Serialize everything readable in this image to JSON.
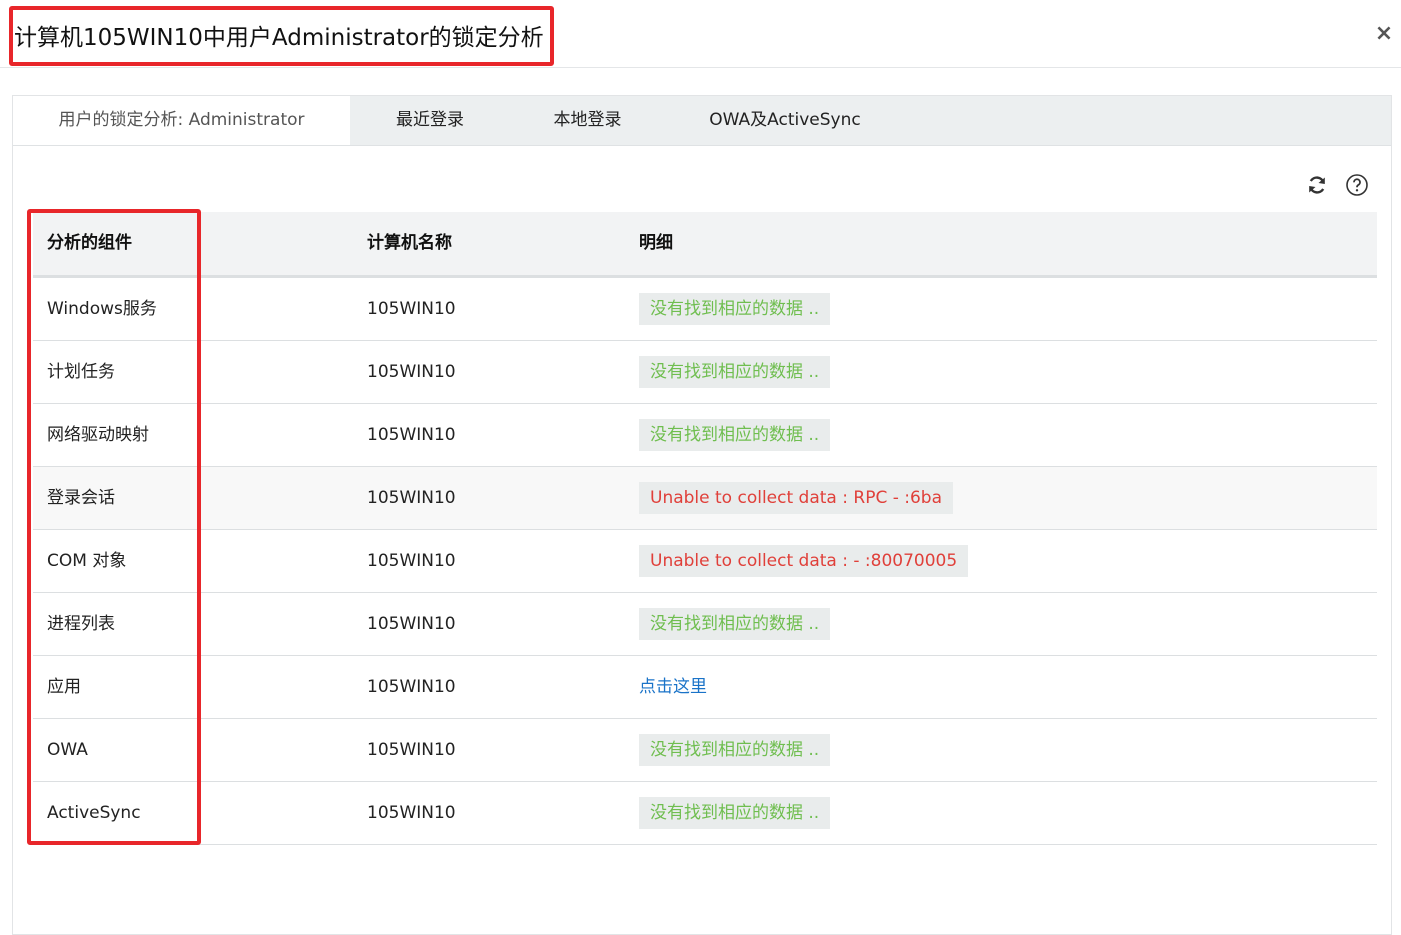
{
  "dialog": {
    "title": "计算机105WIN10中用户Administrator的锁定分析",
    "close_label": "×"
  },
  "tabs": [
    {
      "label": "用户的锁定分析: Administrator",
      "active": true
    },
    {
      "label": "最近登录",
      "active": false
    },
    {
      "label": "本地登录",
      "active": false
    },
    {
      "label": "OWA及ActiveSync",
      "active": false
    }
  ],
  "toolbar": {
    "refresh_icon": "refresh-icon",
    "help_icon": "help-icon"
  },
  "table": {
    "headers": [
      "分析的组件",
      "计算机名称",
      "明细"
    ],
    "rows": [
      {
        "component": "Windows服务",
        "computer": "105WIN10",
        "detail": "没有找到相应的数据 ..",
        "status": "ok"
      },
      {
        "component": "计划任务",
        "computer": "105WIN10",
        "detail": "没有找到相应的数据 ..",
        "status": "ok"
      },
      {
        "component": "网络驱动映射",
        "computer": "105WIN10",
        "detail": "没有找到相应的数据 ..",
        "status": "ok"
      },
      {
        "component": "登录会话",
        "computer": "105WIN10",
        "detail": "Unable to collect data : RPC - :6ba",
        "status": "err"
      },
      {
        "component": "COM 对象",
        "computer": "105WIN10",
        "detail": "Unable to collect data : - :80070005",
        "status": "err"
      },
      {
        "component": "进程列表",
        "computer": "105WIN10",
        "detail": "没有找到相应的数据 ..",
        "status": "ok"
      },
      {
        "component": "应用",
        "computer": "105WIN10",
        "detail": "点击这里",
        "status": "link"
      },
      {
        "component": "OWA",
        "computer": "105WIN10",
        "detail": "没有找到相应的数据 ..",
        "status": "ok"
      },
      {
        "component": "ActiveSync",
        "computer": "105WIN10",
        "detail": "没有找到相应的数据 ..",
        "status": "ok"
      }
    ]
  },
  "colors": {
    "highlight": "#e8262a",
    "ok_text": "#6fbe4f",
    "error_text": "#e0403a",
    "link_text": "#1a73c8"
  }
}
